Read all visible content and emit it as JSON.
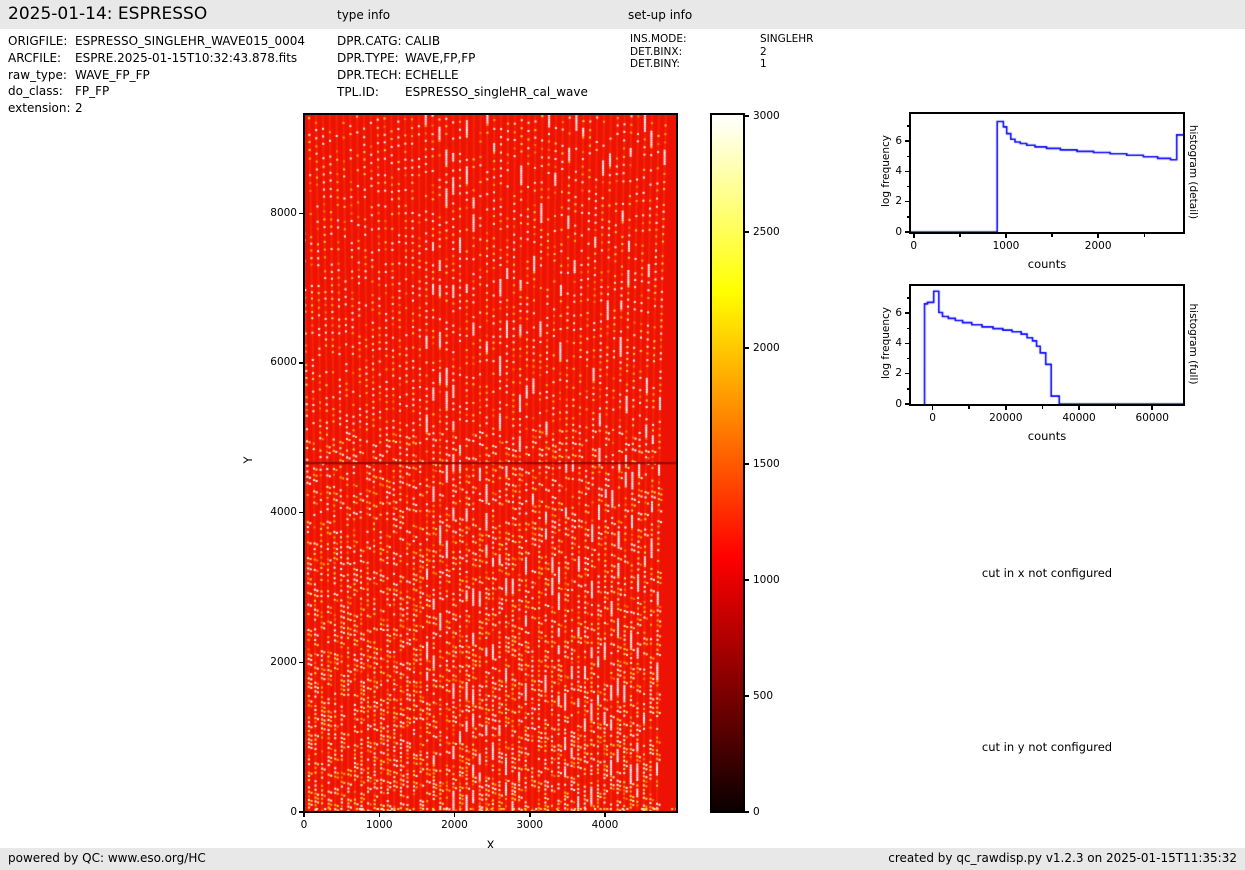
{
  "header": {
    "title": "2025-01-14: ESPRESSO",
    "type_info_label": "type info",
    "setup_info_label": "set-up info"
  },
  "file_info": {
    "rows": [
      {
        "label": "ORIGFILE:",
        "value": "ESPRESSO_SINGLEHR_WAVE015_0004"
      },
      {
        "label": "ARCFILE:",
        "value": "ESPRE.2025-01-15T10:32:43.878.fits"
      },
      {
        "label": "raw_type:",
        "value": "WAVE_FP_FP"
      },
      {
        "label": "do_class:",
        "value": "FP_FP"
      },
      {
        "label": "extension:",
        "value": "2"
      }
    ]
  },
  "type_info": {
    "rows": [
      {
        "label": "DPR.CATG:",
        "value": "CALIB"
      },
      {
        "label": "DPR.TYPE:",
        "value": "WAVE,FP,FP"
      },
      {
        "label": "DPR.TECH:",
        "value": "ECHELLE"
      },
      {
        "label": "TPL.ID:",
        "value": "ESPRESSO_singleHR_cal_wave"
      }
    ]
  },
  "setup_info": {
    "rows": [
      {
        "label": "INS.MODE:",
        "value": "SINGLEHR"
      },
      {
        "label": "DET.BINX:",
        "value": "2"
      },
      {
        "label": "DET.BINY:",
        "value": "1"
      }
    ]
  },
  "messages": {
    "cut_x": "cut in x not configured",
    "cut_y": "cut in y not configured"
  },
  "footer": {
    "left": "powered by QC: www.eso.org/HC",
    "right": "created by qc_rawdisp.py v1.2.3 on 2025-01-15T11:35:32"
  },
  "colors": {
    "panel_bg": "#e8e8e8",
    "page_bg": "#ffffff",
    "hist_line": "#0000ff",
    "heat_background": "#ee1205",
    "heat_trace_glow": "rgba(255,70,0,0.38)",
    "heat_dark_row": "rgba(140,10,0,0.9)",
    "axis": "#000000"
  },
  "chart_data": [
    {
      "id": "raw-frame",
      "type": "heatmap",
      "title": "",
      "xlabel": "X",
      "ylabel": "Y",
      "xlim": [
        0,
        4930
      ],
      "ylim": [
        0,
        9300
      ],
      "xticks": [
        0,
        1000,
        2000,
        3000,
        4000
      ],
      "yticks": [
        0,
        2000,
        4000,
        6000,
        8000
      ],
      "colormap": "hot",
      "colormap_stops": [
        [
          "#0b0000",
          0
        ],
        [
          "#ff0000",
          0.365
        ],
        [
          "#ffff00",
          0.746
        ],
        [
          "#ffffff",
          1
        ]
      ],
      "value_range": [
        0,
        3000
      ],
      "colorbar_ticks": [
        0,
        500,
        1000,
        1500,
        2000,
        2500,
        3000
      ],
      "n_orders": 54,
      "dark_row_y": 4650,
      "dot_colors": [
        "#ffffff",
        "#fff9c9",
        "#ffe23d",
        "#ffb400",
        "#ff7e00"
      ],
      "description": "ESPRESSO raw echelle frame: ~54 near-vertical spectral order traces of dotted Fabry-Perot emission lines (white/yellow) on a red bias background (~1000 counts), dark detector-gap row at y=4650, solid red margins at left/right edges"
    },
    {
      "id": "histogram-detail",
      "type": "line",
      "style": "step",
      "xlabel": "counts",
      "ylabel": "log frequency",
      "right_label": "histogram (detail)",
      "xlim": [
        -30,
        2920
      ],
      "ylim": [
        0,
        7.8
      ],
      "xticks": [
        0,
        1000,
        2000
      ],
      "xticks_minor": [
        500,
        1500,
        2500
      ],
      "yticks": [
        0,
        2,
        4,
        6
      ],
      "yticks_minor": [
        1,
        3,
        5,
        7
      ],
      "line_color": "#0000ff",
      "steps": [
        [
          -30,
          0
        ],
        [
          905,
          0
        ],
        [
          905,
          7.3
        ],
        [
          972,
          7.3
        ],
        [
          972,
          6.95
        ],
        [
          1008,
          6.95
        ],
        [
          1008,
          6.5
        ],
        [
          1052,
          6.5
        ],
        [
          1052,
          6.13
        ],
        [
          1098,
          6.13
        ],
        [
          1098,
          5.95
        ],
        [
          1155,
          5.95
        ],
        [
          1155,
          5.85
        ],
        [
          1225,
          5.85
        ],
        [
          1225,
          5.73
        ],
        [
          1315,
          5.73
        ],
        [
          1315,
          5.63
        ],
        [
          1440,
          5.63
        ],
        [
          1440,
          5.53
        ],
        [
          1590,
          5.53
        ],
        [
          1590,
          5.43
        ],
        [
          1770,
          5.43
        ],
        [
          1770,
          5.33
        ],
        [
          1950,
          5.33
        ],
        [
          1950,
          5.26
        ],
        [
          2130,
          5.26
        ],
        [
          2130,
          5.17
        ],
        [
          2310,
          5.17
        ],
        [
          2310,
          5.07
        ],
        [
          2490,
          5.07
        ],
        [
          2490,
          4.97
        ],
        [
          2645,
          4.97
        ],
        [
          2645,
          4.87
        ],
        [
          2785,
          4.87
        ],
        [
          2785,
          4.78
        ],
        [
          2852,
          4.78
        ],
        [
          2852,
          6.42
        ],
        [
          2920,
          6.42
        ]
      ]
    },
    {
      "id": "histogram-full",
      "type": "line",
      "style": "step",
      "xlabel": "counts",
      "ylabel": "log frequency",
      "right_label": "histogram (full)",
      "xlim": [
        -5900,
        68400
      ],
      "ylim": [
        0,
        7.8
      ],
      "xticks": [
        0,
        20000,
        40000,
        60000
      ],
      "xticks_minor": [
        10000,
        30000,
        50000
      ],
      "yticks": [
        0,
        2,
        4,
        6
      ],
      "yticks_minor": [
        1,
        3,
        5,
        7
      ],
      "line_color": "#0000ff",
      "steps": [
        [
          -2200,
          0
        ],
        [
          -2200,
          6.62
        ],
        [
          -1400,
          6.62
        ],
        [
          -1400,
          6.72
        ],
        [
          300,
          6.72
        ],
        [
          300,
          7.45
        ],
        [
          1700,
          7.45
        ],
        [
          1700,
          6.05
        ],
        [
          2700,
          6.05
        ],
        [
          2700,
          5.78
        ],
        [
          4300,
          5.78
        ],
        [
          4300,
          5.66
        ],
        [
          6200,
          5.66
        ],
        [
          6200,
          5.52
        ],
        [
          8200,
          5.52
        ],
        [
          8200,
          5.38
        ],
        [
          10700,
          5.38
        ],
        [
          10700,
          5.24
        ],
        [
          13500,
          5.24
        ],
        [
          13500,
          5.1
        ],
        [
          16500,
          5.1
        ],
        [
          16500,
          4.98
        ],
        [
          19200,
          4.98
        ],
        [
          19200,
          4.88
        ],
        [
          21700,
          4.88
        ],
        [
          21700,
          4.78
        ],
        [
          24200,
          4.78
        ],
        [
          24200,
          4.62
        ],
        [
          25800,
          4.62
        ],
        [
          25800,
          4.38
        ],
        [
          27300,
          4.38
        ],
        [
          27300,
          4.17
        ],
        [
          28400,
          4.17
        ],
        [
          28400,
          3.82
        ],
        [
          29400,
          3.82
        ],
        [
          29400,
          3.38
        ],
        [
          30900,
          3.38
        ],
        [
          30900,
          2.62
        ],
        [
          32400,
          2.62
        ],
        [
          32400,
          0.52
        ],
        [
          34600,
          0.52
        ],
        [
          34600,
          0
        ],
        [
          68400,
          0
        ]
      ]
    }
  ]
}
